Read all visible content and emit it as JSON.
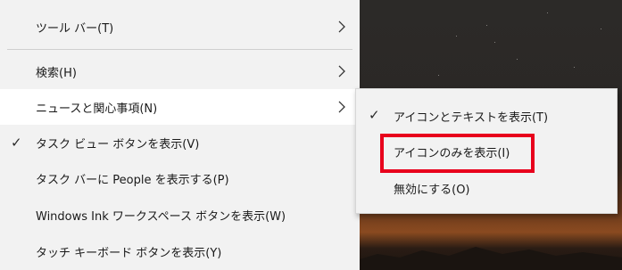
{
  "context_menu": {
    "items": [
      {
        "label": "ツール バー(T)",
        "checked": false,
        "has_submenu": true
      },
      {
        "label": "検索(H)",
        "checked": false,
        "has_submenu": true
      },
      {
        "label": "ニュースと関心事項(N)",
        "checked": false,
        "has_submenu": true,
        "highlighted": true
      },
      {
        "label": "タスク ビュー ボタンを表示(V)",
        "checked": true,
        "has_submenu": false
      },
      {
        "label": "タスク バーに People を表示する(P)",
        "checked": false,
        "has_submenu": false
      },
      {
        "label": "Windows Ink ワークスペース ボタンを表示(W)",
        "checked": false,
        "has_submenu": false
      },
      {
        "label": "タッチ キーボード ボタンを表示(Y)",
        "checked": false,
        "has_submenu": false
      }
    ]
  },
  "submenu": {
    "items": [
      {
        "label": "アイコンとテキストを表示(T)",
        "checked": true
      },
      {
        "label": "アイコンのみを表示(I)",
        "checked": false,
        "annotated": true
      },
      {
        "label": "無効にする(O)",
        "checked": false
      }
    ]
  },
  "icons": {
    "check": "checkmark-icon",
    "chevron": "chevron-right-icon"
  },
  "colors": {
    "menu_bg": "#f2f2f2",
    "highlight_bg": "#ffffff",
    "annotation_red": "#e8001c"
  },
  "glyphs": {
    "check": "✓"
  }
}
